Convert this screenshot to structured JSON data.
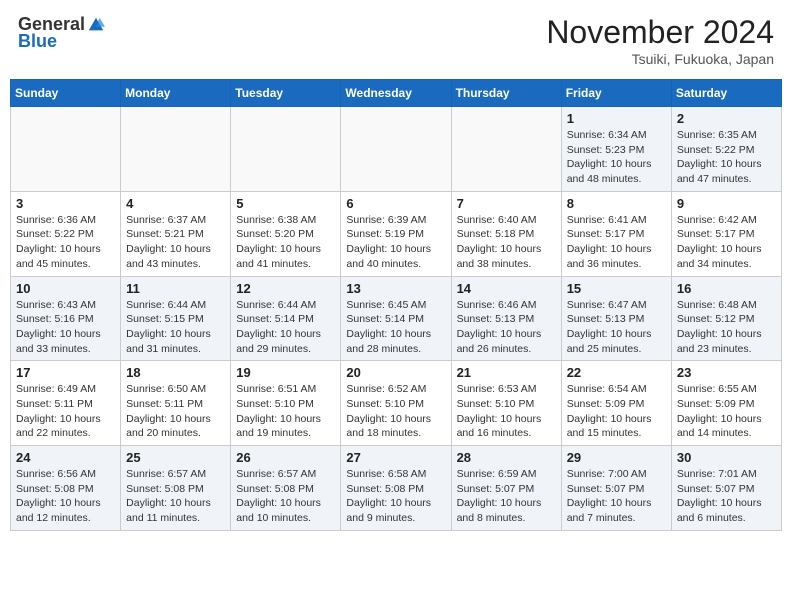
{
  "header": {
    "logo_general": "General",
    "logo_blue": "Blue",
    "month_title": "November 2024",
    "location": "Tsuiki, Fukuoka, Japan"
  },
  "calendar": {
    "days_of_week": [
      "Sunday",
      "Monday",
      "Tuesday",
      "Wednesday",
      "Thursday",
      "Friday",
      "Saturday"
    ],
    "weeks": [
      [
        {
          "day": "",
          "info": ""
        },
        {
          "day": "",
          "info": ""
        },
        {
          "day": "",
          "info": ""
        },
        {
          "day": "",
          "info": ""
        },
        {
          "day": "",
          "info": ""
        },
        {
          "day": "1",
          "info": "Sunrise: 6:34 AM\nSunset: 5:23 PM\nDaylight: 10 hours\nand 48 minutes."
        },
        {
          "day": "2",
          "info": "Sunrise: 6:35 AM\nSunset: 5:22 PM\nDaylight: 10 hours\nand 47 minutes."
        }
      ],
      [
        {
          "day": "3",
          "info": "Sunrise: 6:36 AM\nSunset: 5:22 PM\nDaylight: 10 hours\nand 45 minutes."
        },
        {
          "day": "4",
          "info": "Sunrise: 6:37 AM\nSunset: 5:21 PM\nDaylight: 10 hours\nand 43 minutes."
        },
        {
          "day": "5",
          "info": "Sunrise: 6:38 AM\nSunset: 5:20 PM\nDaylight: 10 hours\nand 41 minutes."
        },
        {
          "day": "6",
          "info": "Sunrise: 6:39 AM\nSunset: 5:19 PM\nDaylight: 10 hours\nand 40 minutes."
        },
        {
          "day": "7",
          "info": "Sunrise: 6:40 AM\nSunset: 5:18 PM\nDaylight: 10 hours\nand 38 minutes."
        },
        {
          "day": "8",
          "info": "Sunrise: 6:41 AM\nSunset: 5:17 PM\nDaylight: 10 hours\nand 36 minutes."
        },
        {
          "day": "9",
          "info": "Sunrise: 6:42 AM\nSunset: 5:17 PM\nDaylight: 10 hours\nand 34 minutes."
        }
      ],
      [
        {
          "day": "10",
          "info": "Sunrise: 6:43 AM\nSunset: 5:16 PM\nDaylight: 10 hours\nand 33 minutes."
        },
        {
          "day": "11",
          "info": "Sunrise: 6:44 AM\nSunset: 5:15 PM\nDaylight: 10 hours\nand 31 minutes."
        },
        {
          "day": "12",
          "info": "Sunrise: 6:44 AM\nSunset: 5:14 PM\nDaylight: 10 hours\nand 29 minutes."
        },
        {
          "day": "13",
          "info": "Sunrise: 6:45 AM\nSunset: 5:14 PM\nDaylight: 10 hours\nand 28 minutes."
        },
        {
          "day": "14",
          "info": "Sunrise: 6:46 AM\nSunset: 5:13 PM\nDaylight: 10 hours\nand 26 minutes."
        },
        {
          "day": "15",
          "info": "Sunrise: 6:47 AM\nSunset: 5:13 PM\nDaylight: 10 hours\nand 25 minutes."
        },
        {
          "day": "16",
          "info": "Sunrise: 6:48 AM\nSunset: 5:12 PM\nDaylight: 10 hours\nand 23 minutes."
        }
      ],
      [
        {
          "day": "17",
          "info": "Sunrise: 6:49 AM\nSunset: 5:11 PM\nDaylight: 10 hours\nand 22 minutes."
        },
        {
          "day": "18",
          "info": "Sunrise: 6:50 AM\nSunset: 5:11 PM\nDaylight: 10 hours\nand 20 minutes."
        },
        {
          "day": "19",
          "info": "Sunrise: 6:51 AM\nSunset: 5:10 PM\nDaylight: 10 hours\nand 19 minutes."
        },
        {
          "day": "20",
          "info": "Sunrise: 6:52 AM\nSunset: 5:10 PM\nDaylight: 10 hours\nand 18 minutes."
        },
        {
          "day": "21",
          "info": "Sunrise: 6:53 AM\nSunset: 5:10 PM\nDaylight: 10 hours\nand 16 minutes."
        },
        {
          "day": "22",
          "info": "Sunrise: 6:54 AM\nSunset: 5:09 PM\nDaylight: 10 hours\nand 15 minutes."
        },
        {
          "day": "23",
          "info": "Sunrise: 6:55 AM\nSunset: 5:09 PM\nDaylight: 10 hours\nand 14 minutes."
        }
      ],
      [
        {
          "day": "24",
          "info": "Sunrise: 6:56 AM\nSunset: 5:08 PM\nDaylight: 10 hours\nand 12 minutes."
        },
        {
          "day": "25",
          "info": "Sunrise: 6:57 AM\nSunset: 5:08 PM\nDaylight: 10 hours\nand 11 minutes."
        },
        {
          "day": "26",
          "info": "Sunrise: 6:57 AM\nSunset: 5:08 PM\nDaylight: 10 hours\nand 10 minutes."
        },
        {
          "day": "27",
          "info": "Sunrise: 6:58 AM\nSunset: 5:08 PM\nDaylight: 10 hours\nand 9 minutes."
        },
        {
          "day": "28",
          "info": "Sunrise: 6:59 AM\nSunset: 5:07 PM\nDaylight: 10 hours\nand 8 minutes."
        },
        {
          "day": "29",
          "info": "Sunrise: 7:00 AM\nSunset: 5:07 PM\nDaylight: 10 hours\nand 7 minutes."
        },
        {
          "day": "30",
          "info": "Sunrise: 7:01 AM\nSunset: 5:07 PM\nDaylight: 10 hours\nand 6 minutes."
        }
      ]
    ]
  }
}
